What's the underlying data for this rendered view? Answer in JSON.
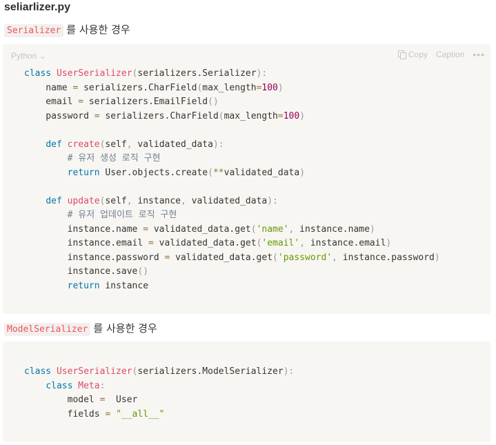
{
  "file_title": "seliarlizer.py",
  "sections": [
    {
      "code_label": "Serializer",
      "heading_suffix": "를 사용한 경우",
      "block": {
        "language": "Python",
        "copy_label": "Copy",
        "caption_label": "Caption",
        "lines": [
          "class UserSerializer(serializers.Serializer):",
          "    name = serializers.CharField(max_length=100)",
          "    email = serializers.EmailField()",
          "    password = serializers.CharField(max_length=100)",
          "",
          "    def create(self, validated_data):",
          "        # 유저 생성 로직 구현",
          "        return User.objects.create(**validated_data)",
          "",
          "    def update(self, instance, validated_data):",
          "        # 유저 업데이트 로직 구현",
          "        instance.name = validated_data.get('name', instance.name)",
          "        instance.email = validated_data.get('email', instance.email)",
          "        instance.password = validated_data.get('password', instance.password)",
          "        instance.save()",
          "        return instance"
        ]
      }
    },
    {
      "code_label": "ModelSerializer",
      "heading_suffix": "를 사용한 경우",
      "block": {
        "lines": [
          "class UserSerializer(serializers.ModelSerializer):",
          "    class Meta:",
          "        model =  User",
          "        fields = \"__all__\""
        ]
      }
    }
  ]
}
